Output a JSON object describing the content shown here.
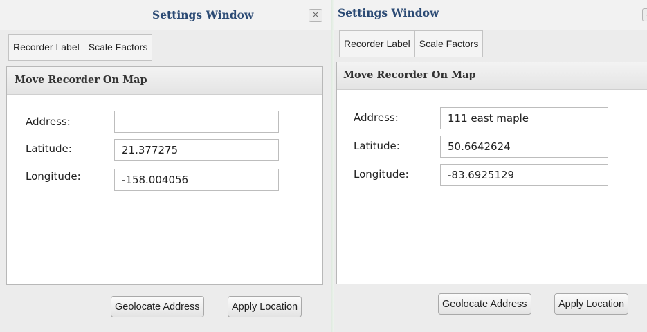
{
  "windows": [
    {
      "title": "Settings Window",
      "close_glyph": "×",
      "tabs": [
        "Recorder Label",
        "Scale Factors"
      ],
      "section_title": "Move Recorder On Map",
      "address_label": "Address:",
      "address_value": "",
      "latitude_label": "Latitude:",
      "latitude_value": "21.377275",
      "longitude_label": "Longitude:",
      "longitude_value": "-158.004056",
      "geolocate_label": "Geolocate Address",
      "apply_label": "Apply Location"
    },
    {
      "title": "Settings Window",
      "close_glyph": "×",
      "tabs": [
        "Recorder Label",
        "Scale Factors"
      ],
      "section_title": "Move Recorder On Map",
      "address_label": "Address:",
      "address_value": "111 east maple",
      "latitude_label": "Latitude:",
      "latitude_value": "50.6642624",
      "longitude_label": "Longitude:",
      "longitude_value": "-83.6925129",
      "geolocate_label": "Geolocate Address",
      "apply_label": "Apply Location"
    }
  ]
}
